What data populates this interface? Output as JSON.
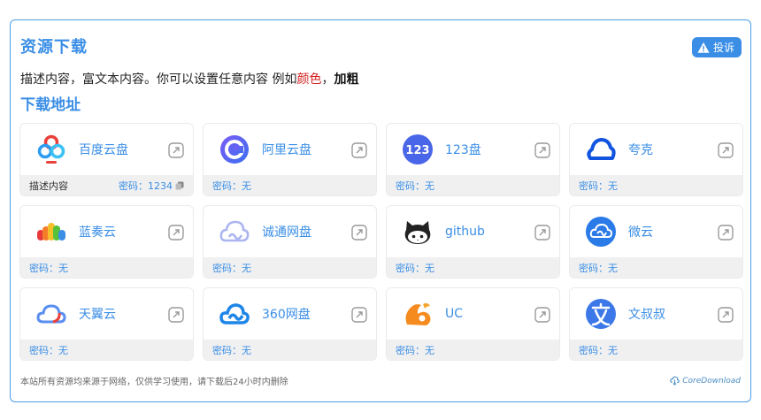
{
  "header": {
    "title": "资源下载",
    "report_label": "投诉"
  },
  "description": {
    "prefix": "描述内容，富文本内容。你可以设置任意内容 例如",
    "colored": "颜色",
    "sep": "，",
    "bold": "加粗"
  },
  "section_title": "下载地址",
  "cards": [
    {
      "name": "百度云盘",
      "note": "描述内容",
      "password": "密码：1234",
      "icon": "baidu-cloud-icon"
    },
    {
      "name": "阿里云盘",
      "password": "密码：无",
      "icon": "aliyun-drive-icon"
    },
    {
      "name": "123盘",
      "password": "密码：无",
      "icon": "123pan-icon"
    },
    {
      "name": "夸克",
      "password": "密码：无",
      "icon": "quark-icon"
    },
    {
      "name": "蓝奏云",
      "password": "密码：无",
      "icon": "lanzou-icon"
    },
    {
      "name": "诚通网盘",
      "password": "密码：无",
      "icon": "ctfile-icon"
    },
    {
      "name": "github",
      "password": "密码：无",
      "icon": "github-icon"
    },
    {
      "name": "微云",
      "password": "密码：无",
      "icon": "weiyun-icon"
    },
    {
      "name": "天翼云",
      "password": "密码：无",
      "icon": "tianyi-cloud-icon"
    },
    {
      "name": "360网盘",
      "password": "密码：无",
      "icon": "360pan-icon"
    },
    {
      "name": "UC",
      "password": "密码：无",
      "icon": "uc-icon"
    },
    {
      "name": "文叔叔",
      "password": "密码：无",
      "icon": "wenshushu-icon"
    }
  ],
  "footer": {
    "notice": "本站所有资源均来源于网络，仅供学习使用，请下载后24小时内删除",
    "brand": "CoreDownload"
  },
  "colors": {
    "accent": "#3a8ee6",
    "highlight_red": "#d42020"
  }
}
